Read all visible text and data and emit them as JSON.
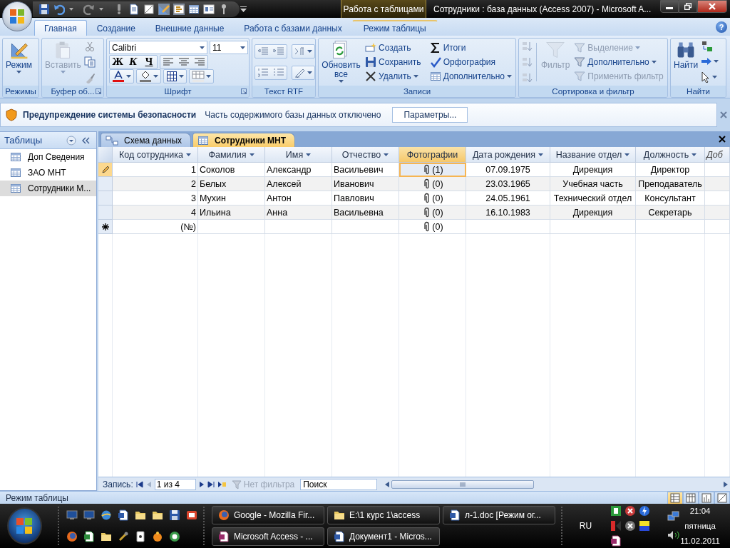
{
  "window": {
    "context_tab": "Работа с таблицами",
    "title": "Сотрудники : база данных (Access 2007) - Microsoft A..."
  },
  "ribbon_tabs": [
    {
      "label": "Главная",
      "selected": true,
      "contextual": false
    },
    {
      "label": "Создание",
      "selected": false,
      "contextual": false
    },
    {
      "label": "Внешние данные",
      "selected": false,
      "contextual": false
    },
    {
      "label": "Работа с базами данных",
      "selected": false,
      "contextual": false
    },
    {
      "label": "Режим таблицы",
      "selected": false,
      "contextual": true
    }
  ],
  "help": "?",
  "ribbon_groups": [
    {
      "kind": "modes",
      "label": "Режимы",
      "large": {
        "label": "Режим",
        "disabled": false,
        "dropdown": true
      }
    },
    {
      "kind": "clipboard",
      "label": "Буфер об...",
      "large": {
        "label": "Вставить",
        "disabled": true,
        "dropdown": true
      }
    },
    {
      "kind": "font",
      "label": "Шрифт",
      "font": "Calibri",
      "size": "11",
      "styles": [
        "Ж",
        "К",
        "Ч"
      ]
    },
    {
      "kind": "rtf",
      "label": "Текст RTF"
    },
    {
      "kind": "records",
      "label": "Записи",
      "large": {
        "label": "Обновить все",
        "disabled": false,
        "dropdown": true
      },
      "items": [
        {
          "label": "Создать",
          "disabled": false,
          "dropdown": false
        },
        {
          "label": "Сохранить",
          "disabled": false,
          "dropdown": false
        },
        {
          "label": "Удалить",
          "disabled": false,
          "dropdown": true
        },
        {
          "label": "Итоги",
          "disabled": false,
          "dropdown": false
        },
        {
          "label": "Орфография",
          "disabled": false,
          "dropdown": false
        },
        {
          "label": "Дополнительно",
          "disabled": false,
          "dropdown": true
        }
      ]
    },
    {
      "kind": "sort",
      "label": "Сортировка и фильтр",
      "large": {
        "label": "Фильтр",
        "disabled": true,
        "dropdown": false
      },
      "items": [
        {
          "label": "Выделение",
          "disabled": true,
          "dropdown": true
        },
        {
          "label": "Дополнительно",
          "disabled": false,
          "dropdown": true
        },
        {
          "label": "Применить фильтр",
          "disabled": true,
          "dropdown": false
        }
      ]
    },
    {
      "kind": "find",
      "label": "Найти",
      "large": {
        "label": "Найти",
        "disabled": false,
        "dropdown": false
      }
    }
  ],
  "security_bar": {
    "title": "Предупреждение системы безопасности",
    "message": "Часть содержимого базы данных отключено",
    "button": "Параметры..."
  },
  "nav_pane": {
    "title": "Таблицы",
    "items": [
      {
        "label": "Доп Сведения",
        "selected": false
      },
      {
        "label": "ЗАО МНТ",
        "selected": false
      },
      {
        "label": "Сотрудники М...",
        "selected": true
      }
    ]
  },
  "document_tabs": [
    {
      "label": "Схема данных",
      "kind": "diagram",
      "selected": false
    },
    {
      "label": "Сотрудники МНТ",
      "kind": "table",
      "selected": true
    }
  ],
  "table": {
    "columns": [
      {
        "label": "Код сотрудника",
        "kind": "number",
        "selected": false,
        "filter_menu": true
      },
      {
        "label": "Фамилия",
        "kind": "text",
        "selected": false,
        "filter_menu": true
      },
      {
        "label": "Имя",
        "kind": "text",
        "selected": false,
        "filter_menu": true
      },
      {
        "label": "Отчество",
        "kind": "text",
        "selected": false,
        "filter_menu": true
      },
      {
        "label": "Фотографии",
        "kind": "attachment",
        "selected": true,
        "filter_menu": false
      },
      {
        "label": "Дата рождения",
        "kind": "date",
        "selected": false,
        "filter_menu": true
      },
      {
        "label": "Название отдел",
        "kind": "lookup",
        "selected": false,
        "filter_menu": true
      },
      {
        "label": "Должность",
        "kind": "lookup",
        "selected": false,
        "filter_menu": true
      },
      {
        "label": "Доб",
        "kind": "new",
        "selected": false,
        "filter_menu": false
      }
    ],
    "rows": [
      {
        "kind": "editing",
        "selected": true,
        "cells": [
          "1",
          "Соколов",
          "Александр",
          "Васильевич",
          "(1)",
          "07.09.1975",
          "Дирекция",
          "Директор",
          null
        ]
      },
      {
        "kind": "normal",
        "selected": false,
        "cells": [
          "2",
          "Белых",
          "Алексей",
          "Иванович",
          "(0)",
          "23.03.1965",
          "Учебная часть",
          "Преподаватель",
          null
        ]
      },
      {
        "kind": "normal",
        "selected": false,
        "cells": [
          "3",
          "Мухин",
          "Антон",
          "Павлович",
          "(0)",
          "24.05.1961",
          "Технический отдел",
          "Консультант",
          null
        ]
      },
      {
        "kind": "normal",
        "selected": false,
        "cells": [
          "4",
          "Ильина",
          "Анна",
          "Васильевна",
          "(0)",
          "16.10.1983",
          "Дирекция",
          "Секретарь",
          null
        ]
      },
      {
        "kind": "new",
        "selected": false,
        "cells": [
          "(№)",
          null,
          null,
          null,
          "(0)",
          null,
          null,
          null,
          null
        ]
      }
    ]
  },
  "record_nav": {
    "label": "Запись:",
    "position": "1 из 4",
    "filter": "Нет фильтра",
    "filter_disabled": true,
    "search_placeholder": "Поиск"
  },
  "status_bar": {
    "text": "Режим таблицы",
    "views": [
      {
        "selected": true
      },
      {
        "selected": false
      },
      {
        "selected": false
      },
      {
        "selected": false
      }
    ]
  },
  "taskbar": {
    "tasks": [
      {
        "label": "Google - Mozilla Fir...",
        "kind": "browser"
      },
      {
        "label": "E:\\1 курс 1\\access",
        "kind": "folder"
      },
      {
        "label": "л-1.doc [Режим ог...",
        "kind": "word"
      },
      {
        "label": "Microsoft Access - ...",
        "kind": "access"
      },
      {
        "label": "Документ1 - Micros...",
        "kind": "word"
      }
    ],
    "language": "RU",
    "time": "21:04",
    "weekday": "пятница",
    "date": "11.02.2011"
  }
}
